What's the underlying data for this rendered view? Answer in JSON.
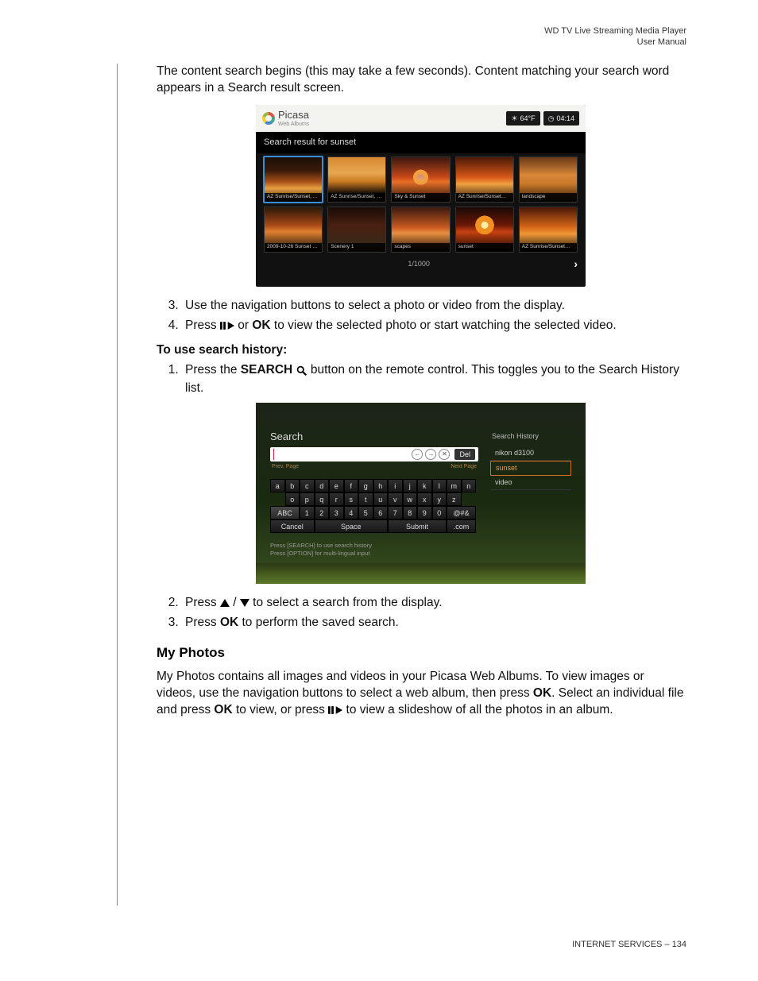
{
  "header": {
    "line1": "WD TV Live Streaming Media Player",
    "line2": "User Manual"
  },
  "body": {
    "intro": "The content search begins (this may take a few seconds). Content matching your search word appears in a Search result screen.",
    "step3": "Use the navigation buttons to select a photo or video from the display.",
    "step4_pre": "Press ",
    "step4_mid": " or ",
    "step4_ok": "OK",
    "step4_post": " to view the selected photo or start watching the selected video.",
    "history_heading": "To use search history:",
    "h1_pre": "Press the ",
    "h1_search": "SEARCH",
    "h1_post": " button on the remote control. This toggles you to the Search History list.",
    "h2_pre": "Press ",
    "h2_mid": " / ",
    "h2_post": " to select a search from the display.",
    "h3_pre": "Press ",
    "h3_ok": "OK",
    "h3_post": " to perform the saved search.",
    "myphotos_heading": "My Photos",
    "myphotos_p1a": "My Photos contains all images and videos in your Picasa Web Albums. To view images or videos, use the navigation buttons to select a web album, then press ",
    "myphotos_ok1": "OK",
    "myphotos_p1b": ". Select an individual file and press ",
    "myphotos_ok2": "OK",
    "myphotos_p1c": " to view, or press ",
    "myphotos_p1d": " to view a slideshow of all the photos in an album."
  },
  "shot1": {
    "logo": "Picasa",
    "logo_sub": "Web Albums",
    "temp": "64°F",
    "time": "04:14",
    "bar": "Search result for sunset",
    "thumbs_row1": [
      "AZ Sunrise/Sunset, A…",
      "AZ Sunrise/Sunset, …",
      "Sky & Sunset",
      "AZ Sunrise/Sunset…",
      "landscape"
    ],
    "thumbs_row2": [
      "2009-10-26 Sunset …",
      "Scenery 1",
      "scapes",
      "sunset",
      "AZ Sunrise/Sunset…"
    ],
    "page": "1/1000"
  },
  "shot2": {
    "title": "Search",
    "del": "Del",
    "prev_page": "Prev. Page",
    "next_page": "Next Page",
    "row1": [
      "a",
      "b",
      "c",
      "d",
      "e",
      "f",
      "g",
      "h",
      "i",
      "j",
      "k",
      "l",
      "m",
      "n"
    ],
    "row2_lead": "",
    "row2": [
      "o",
      "p",
      "q",
      "r",
      "s",
      "t",
      "u",
      "v",
      "w",
      "x",
      "y",
      "z"
    ],
    "row3_abc": "ABC",
    "row3": [
      "1",
      "2",
      "3",
      "4",
      "5",
      "6",
      "7",
      "8",
      "9",
      "0"
    ],
    "row3_sym": "@#&",
    "row4": {
      "cancel": "Cancel",
      "space": "Space",
      "submit": "Submit",
      "com": ".com"
    },
    "history_title": "Search History",
    "history": [
      "nikon d3100",
      "sunset",
      "video"
    ],
    "hint1": "Press [SEARCH] to use search history",
    "hint2": "Press [OPTION] for multi-lingual input"
  },
  "footer": {
    "section": "INTERNET SERVICES",
    "dash": " – ",
    "page": "134"
  }
}
